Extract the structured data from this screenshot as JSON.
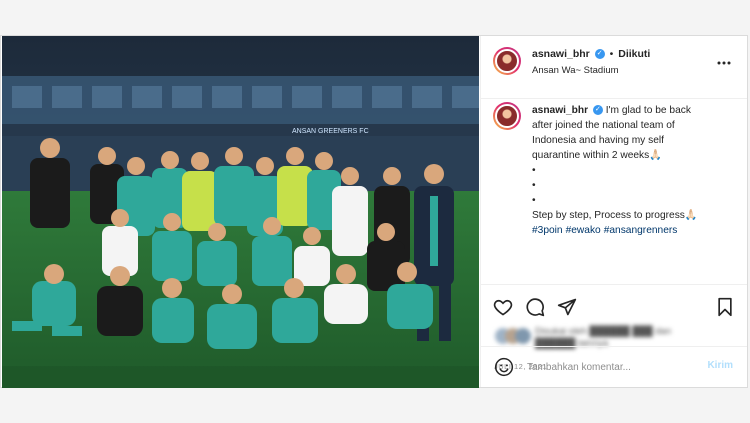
{
  "post": {
    "username": "asnawi_bhr",
    "separator": "•",
    "follow_label": "Diikuti",
    "location": "Ansan Wa~ Stadium",
    "more_icon": "more-horizontal-icon",
    "caption": {
      "username": "asnawi_bhr",
      "line1": "I'm glad to be back",
      "line2": "after joined the national team of",
      "line3": "Indonesia and having my self",
      "line4": "quarantine within 2 weeks🙏🏻",
      "bullets": [
        "•",
        "•",
        "•"
      ],
      "line5": "Step by step, Process to progress🙏🏻",
      "hashtags": [
        "#3poin",
        "#ewako",
        "#ansangrenners"
      ]
    },
    "likes_text_1": "Disukai oleh",
    "likes_text_2": "dan",
    "likes_text_3": "lainnya",
    "date": "JULI 12, 2021",
    "comment_placeholder": "Tambahkan komentar...",
    "post_button": "Kirim"
  },
  "photo": {
    "banner_text": "ANSAN GREENERS FC",
    "alt": "team-celebration-photo"
  },
  "colors": {
    "link": "#00376b",
    "verified": "#3897f0",
    "post_button": "#b2dffc",
    "jersey_green": "#2fa89a",
    "pitch": "#2d6e37"
  }
}
